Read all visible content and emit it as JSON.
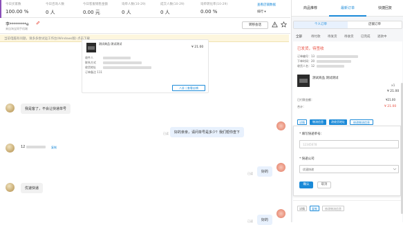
{
  "stats": [
    {
      "label": "今日买家数",
      "value": "100.00 %"
    },
    {
      "label": "今日咨询人数",
      "value": "0 人"
    },
    {
      "label": "今日客服销售金额",
      "value": "0.00 元"
    },
    {
      "label": "询单人数(10-29)",
      "value": "0 人"
    },
    {
      "label": "成交人数(10-29)",
      "value": "0 人"
    },
    {
      "label": "询单转化率(10-29)",
      "value": "0.00 %"
    }
  ],
  "stats_link": "查看店铺数据",
  "stats_sort": "排行 ▾",
  "chat_header": {
    "name": "李********e",
    "sub": "来自淘宝网手机端",
    "transfer": "转移会话"
  },
  "notice": "当前电脑有问题，请多多尝试运工作台(Windows版) 点击下载",
  "order_card": {
    "product": "测试商品·测试测试",
    "price": "¥ 21.00",
    "fields": [
      {
        "k": "收件人",
        "v": ""
      },
      {
        "k": "联系方式",
        "v": ""
      },
      {
        "k": "收货地址",
        "v": ""
      },
      {
        "k": "订单备注",
        "v": "111"
      }
    ],
    "action": "八卦 | 查看店铺"
  },
  "messages": [
    {
      "side": "left",
      "text": "我是客了，不会让快递单号"
    },
    {
      "side": "right",
      "text": "好的亲亲，请问单号是多少？我们帮你查下",
      "time": "已读"
    },
    {
      "side": "left",
      "text": "12",
      "tag": "复制"
    },
    {
      "side": "right",
      "text": "好的",
      "time": "已读"
    },
    {
      "side": "left",
      "text": "优速快递"
    },
    {
      "side": "right",
      "text": "好的",
      "time": "已读"
    }
  ],
  "right_tabs": [
    "商品推荐",
    "最新订单",
    "快捷回复"
  ],
  "sub_tabs": [
    "个人订单",
    "店铺订单"
  ],
  "filters": [
    "全部",
    "待付款",
    "待发货",
    "待收货",
    "已完成",
    "退款中"
  ],
  "order": {
    "status": "已发货，待签收",
    "rows": [
      "订单编号：13",
      "下单时间：20",
      "收货人名：12"
    ],
    "product": "测试商品 测试测试",
    "qty": "x1",
    "price": "¥ 21.00",
    "pay_label": "已付款金额：",
    "pay_value": "¥21.00",
    "total_label": "合计：",
    "total_value": "¥ 21.00",
    "btns": [
      "详情",
      "物流信息",
      "改收货地址",
      "修改物流信息"
    ]
  },
  "ship_form": {
    "title1": "* 填写快递单号：",
    "input1_value": "12345678",
    "title2": "* 快递公司",
    "select_value": "优速快递",
    "confirm": "确认",
    "cancel": "取消"
  },
  "bottom_btns": [
    "详情",
    "复制",
    "修改物流信息"
  ],
  "colors": {
    "accent": "#1b8ad8",
    "danger": "#e84a3c"
  }
}
